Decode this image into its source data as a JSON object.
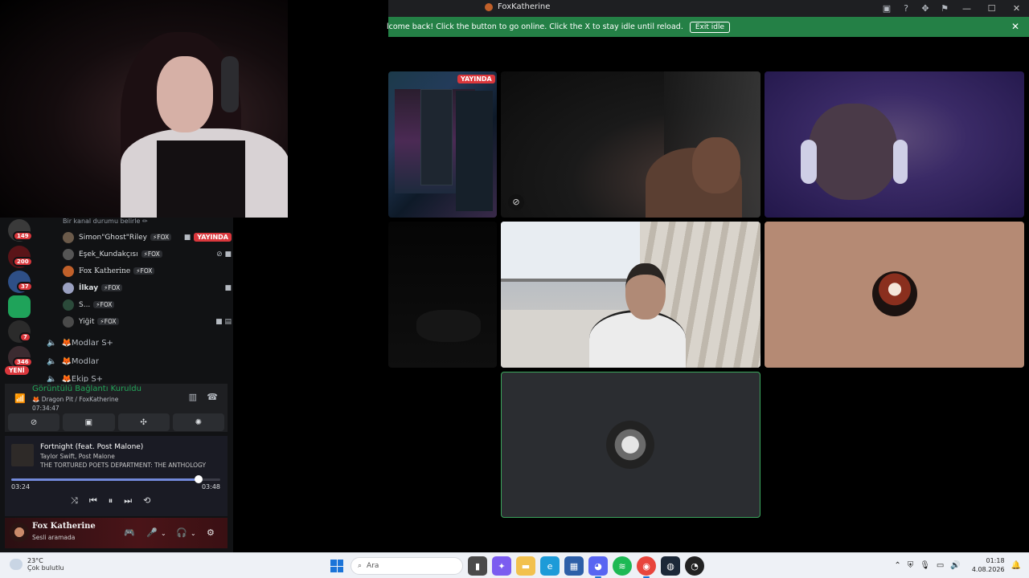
{
  "window": {
    "title": "FoxKatherine",
    "icons": [
      "inbox-icon",
      "help-icon",
      "tools-icon",
      "notify-icon"
    ],
    "controls": [
      "minimize",
      "maximize",
      "close"
    ]
  },
  "notice": {
    "message": "lcome back! Click the button to go online. Click the X to stay idle until reload.",
    "button": "Exit idle",
    "close": "✕"
  },
  "tiles": {
    "screenshare_live_badge": "YAYINDA"
  },
  "sidebar": {
    "guild_badges": [
      "149",
      "200",
      "37",
      "7",
      "346"
    ],
    "new_badge": "YENİ",
    "status_line": "Bir kanal durumu belirle ✏",
    "voice_users": [
      {
        "name": "Simon\"Ghost\"Riley",
        "tag": "⚡FOX",
        "live": "YAYINDA"
      },
      {
        "name": "Eşek_Kundakçısı",
        "tag": "⚡FOX"
      },
      {
        "name": "Fox Katherine",
        "tag": "⚡FOX"
      },
      {
        "name": "İlkay",
        "tag": "⚡FOX"
      },
      {
        "name": "S...",
        "tag": "⚡FOX"
      },
      {
        "name": "Yiğit",
        "tag": "⚡FOX"
      }
    ],
    "channels": [
      {
        "name": "🦊Modlar S+"
      },
      {
        "name": "🦊Modlar"
      },
      {
        "name": "🦊Ekip S+"
      }
    ]
  },
  "voice_connection": {
    "title": "Görüntülü Bağlantı Kuruldu",
    "subtitle": "🦊 Dragon Pit / FoxKatherine",
    "elapsed": "07:34:47"
  },
  "spotify": {
    "song": "Fortnight (feat. Post Malone)",
    "artist": "Taylor Swift, Post Malone",
    "album": "THE TORTURED POETS DEPARTMENT: THE ANTHOLOGY",
    "current": "03:24",
    "total": "03:48",
    "progress": 0.895
  },
  "user": {
    "name": "Fox Katherine",
    "status": "Sesli aramada"
  },
  "taskbar": {
    "temperature": "23°C",
    "weather": "Çok bulutlu",
    "search_placeholder": "Ara",
    "time": "01:18",
    "date": "4.08.2026",
    "accent": "#1b74d8"
  }
}
